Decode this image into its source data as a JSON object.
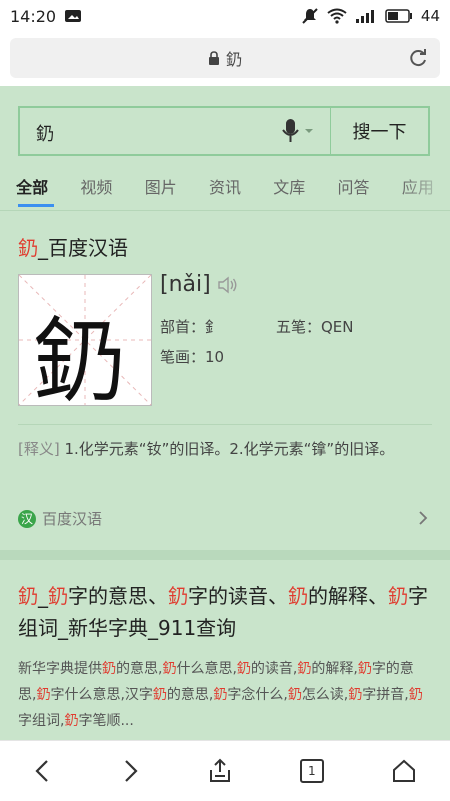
{
  "status_bar": {
    "time": "14:20",
    "battery": "44"
  },
  "address_bar": {
    "url_text": "釢"
  },
  "search": {
    "query": "釢",
    "button_label": "搜一下"
  },
  "tabs": [
    {
      "label": "全部",
      "active": true
    },
    {
      "label": "视频"
    },
    {
      "label": "图片"
    },
    {
      "label": "资讯"
    },
    {
      "label": "文库"
    },
    {
      "label": "问答"
    },
    {
      "label": "应用"
    }
  ],
  "dict_card": {
    "title_highlight": "釢",
    "title_rest": "_百度汉语",
    "character": "釢",
    "pinyin": "[nǎi]",
    "radical": "部首：釒",
    "wubi": "五笔：QEN",
    "strokes": "笔画：10",
    "definition_tag": "[释义]",
    "definition_text": " 1.化学元素“钕”的旧译。2.化学元素“镎”的旧译。",
    "source_badge": "汉",
    "source_name": "百度汉语"
  },
  "result2": {
    "title_parts": [
      "釢",
      "_",
      "釢",
      "字的意思、",
      "釢",
      "字的读音、",
      "釢",
      "的解释、",
      "釢",
      "字组词_新华字典_911查询"
    ],
    "snippet_parts": [
      "新华字典提供",
      "釢",
      "的意思,",
      "釢",
      "什么意思,",
      "釢",
      "的读音,",
      "釢",
      "的解释,",
      "釢",
      "字的意思,",
      "釢",
      "字什么意思,汉字",
      "釢",
      "的意思,",
      "釢",
      "字念什么,",
      "釢",
      "怎么读,",
      "釢",
      "字拼音,",
      "釢",
      "字组词,",
      "釢",
      "字笔顺..."
    ]
  },
  "bottom_nav": {
    "tab_count": "1"
  },
  "colors": {
    "background": "#c9e4cb",
    "highlight": "#e03b2f",
    "accent": "#3b8ff0"
  }
}
